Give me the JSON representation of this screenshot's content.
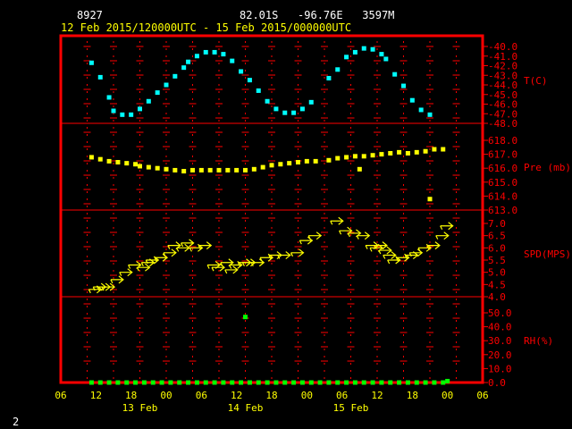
{
  "header": {
    "station": "8927",
    "location": "82.01S   -96.76E   3597M",
    "time_range": "12 Feb 2015/120000UTC - 15 Feb 2015/000000UTC",
    "page_number": "2"
  },
  "colors": {
    "background": "#000000",
    "frame": "#ff0000",
    "grid": "#ff0000",
    "axis_text": "#ff0000",
    "date_text": "#ffff00",
    "temperature": "#00ffff",
    "pressure": "#ffff00",
    "wind": "#ffff00",
    "rh": "#00ff00"
  },
  "chart_data": {
    "type": "scatter",
    "x_unit": "hours since 12 Feb 2015 00 UTC",
    "x_ticks": [
      "06",
      "12",
      "18",
      "00",
      "06",
      "12",
      "18",
      "00",
      "06",
      "12",
      "18",
      "00",
      "06"
    ],
    "date_labels": [
      "13 Feb",
      "14 Feb",
      "15 Feb"
    ],
    "grid": true,
    "panels": [
      {
        "name": "temperature",
        "label": "T(C)",
        "ylim": [
          -48,
          -40
        ],
        "ticks": [
          "-40.0",
          "-41.0",
          "-42.0",
          "-43.0",
          "-44.0",
          "-45.0",
          "-46.0",
          "-47.0",
          "-48.0"
        ],
        "marker": "square",
        "points": [
          [
            13,
            -41.7
          ],
          [
            15,
            -43.2
          ],
          [
            17,
            -45.3
          ],
          [
            18,
            -46.7
          ],
          [
            20,
            -47.1
          ],
          [
            22,
            -47.1
          ],
          [
            24,
            -46.5
          ],
          [
            26,
            -45.7
          ],
          [
            28,
            -44.8
          ],
          [
            30,
            -44.0
          ],
          [
            32,
            -43.1
          ],
          [
            34,
            -42.2
          ],
          [
            35,
            -41.6
          ],
          [
            37,
            -41.0
          ],
          [
            39,
            -40.6
          ],
          [
            41,
            -40.6
          ],
          [
            43,
            -40.8
          ],
          [
            45,
            -41.5
          ],
          [
            47,
            -42.6
          ],
          [
            49,
            -43.5
          ],
          [
            51,
            -44.6
          ],
          [
            53,
            -45.7
          ],
          [
            55,
            -46.5
          ],
          [
            57,
            -46.9
          ],
          [
            59,
            -46.9
          ],
          [
            61,
            -46.5
          ],
          [
            63,
            -45.8
          ],
          [
            67,
            -43.3
          ],
          [
            69,
            -42.4
          ],
          [
            71,
            -41.1
          ],
          [
            73,
            -40.6
          ],
          [
            75,
            -40.2
          ],
          [
            77,
            -40.3
          ],
          [
            79,
            -40.8
          ],
          [
            80,
            -41.3
          ],
          [
            82,
            -42.9
          ],
          [
            84,
            -44.1
          ],
          [
            86,
            -45.6
          ],
          [
            88,
            -46.6
          ],
          [
            90,
            -47.1
          ]
        ]
      },
      {
        "name": "pressure",
        "label": "Pre (mb)",
        "ylim": [
          612,
          619
        ],
        "ticks": [
          "618.0",
          "617.0",
          "616.0",
          "615.0",
          "614.0",
          "613.0"
        ],
        "marker": "square",
        "points": [
          [
            13,
            617.3
          ],
          [
            15,
            617.1
          ],
          [
            17,
            616.9
          ],
          [
            19,
            616.8
          ],
          [
            21,
            616.7
          ],
          [
            23,
            616.6
          ],
          [
            24,
            616.4
          ],
          [
            26,
            616.3
          ],
          [
            28,
            616.2
          ],
          [
            30,
            616.1
          ],
          [
            32,
            616.0
          ],
          [
            34,
            615.9
          ],
          [
            36,
            616.0
          ],
          [
            38,
            616.0
          ],
          [
            40,
            616.0
          ],
          [
            42,
            616.0
          ],
          [
            44,
            616.0
          ],
          [
            46,
            616.0
          ],
          [
            48,
            616.0
          ],
          [
            50,
            616.1
          ],
          [
            52,
            616.3
          ],
          [
            54,
            616.5
          ],
          [
            56,
            616.6
          ],
          [
            58,
            616.7
          ],
          [
            60,
            616.8
          ],
          [
            62,
            616.9
          ],
          [
            64,
            616.9
          ],
          [
            67,
            617.0
          ],
          [
            69,
            617.2
          ],
          [
            71,
            617.3
          ],
          [
            73,
            617.4
          ],
          [
            74,
            616.1
          ],
          [
            75,
            617.4
          ],
          [
            77,
            617.5
          ],
          [
            79,
            617.6
          ],
          [
            81,
            617.7
          ],
          [
            83,
            617.8
          ],
          [
            85,
            617.7
          ],
          [
            87,
            617.8
          ],
          [
            89,
            617.9
          ],
          [
            91,
            618.1
          ],
          [
            93,
            618.1
          ],
          [
            90,
            613.1
          ]
        ]
      },
      {
        "name": "wind_speed",
        "label": "SPD(MPS)",
        "ylim": [
          4,
          7
        ],
        "ticks": [
          "7.0",
          "6.5",
          "6.0",
          "5.5",
          "5.0",
          "4.5",
          "4.0"
        ],
        "marker": "wind-arrow",
        "points": [
          [
            14,
            4.3
          ],
          [
            15,
            4.4
          ],
          [
            16,
            4.4
          ],
          [
            17,
            4.4
          ],
          [
            19,
            4.7
          ],
          [
            21,
            5.0
          ],
          [
            23,
            5.3
          ],
          [
            25,
            5.2
          ],
          [
            26,
            5.4
          ],
          [
            27,
            5.5
          ],
          [
            29,
            5.6
          ],
          [
            31,
            5.8
          ],
          [
            32,
            6.1
          ],
          [
            34,
            6.0
          ],
          [
            35,
            6.2
          ],
          [
            37,
            6.0
          ],
          [
            39,
            6.1
          ],
          [
            41,
            5.3
          ],
          [
            42,
            5.2
          ],
          [
            44,
            5.4
          ],
          [
            45,
            5.1
          ],
          [
            46,
            5.3
          ],
          [
            48,
            5.4
          ],
          [
            49,
            5.4
          ],
          [
            51,
            5.4
          ],
          [
            53,
            5.6
          ],
          [
            55,
            5.7
          ],
          [
            57,
            5.7
          ],
          [
            60,
            5.8
          ],
          [
            62,
            6.3
          ],
          [
            64,
            6.5
          ],
          [
            69,
            7.1
          ],
          [
            71,
            6.7
          ],
          [
            73,
            6.6
          ],
          [
            75,
            6.5
          ],
          [
            77,
            6.1
          ],
          [
            78,
            6.0
          ],
          [
            79,
            6.1
          ],
          [
            80,
            5.9
          ],
          [
            81,
            5.7
          ],
          [
            82,
            5.5
          ],
          [
            84,
            5.6
          ],
          [
            86,
            5.7
          ],
          [
            87,
            5.8
          ],
          [
            89,
            6.0
          ],
          [
            91,
            6.1
          ],
          [
            93,
            6.5
          ],
          [
            94,
            6.9
          ]
        ]
      },
      {
        "name": "relative_humidity",
        "label": "RH(%)",
        "ylim": [
          0,
          50
        ],
        "ticks": [
          "50.0",
          "40.0",
          "30.0",
          "20.0",
          "10.0",
          "0.0"
        ],
        "marker": "square",
        "points": [
          [
            13,
            0
          ],
          [
            15,
            0
          ],
          [
            17,
            0
          ],
          [
            19,
            0
          ],
          [
            21,
            0
          ],
          [
            23,
            0
          ],
          [
            25,
            0
          ],
          [
            27,
            0
          ],
          [
            29,
            0
          ],
          [
            31,
            0
          ],
          [
            33,
            0
          ],
          [
            35,
            0
          ],
          [
            37,
            0
          ],
          [
            39,
            0
          ],
          [
            41,
            0
          ],
          [
            43,
            0
          ],
          [
            45,
            0
          ],
          [
            47,
            0
          ],
          [
            49,
            0
          ],
          [
            51,
            0
          ],
          [
            53,
            0
          ],
          [
            55,
            0
          ],
          [
            57,
            0
          ],
          [
            59,
            0
          ],
          [
            61,
            0
          ],
          [
            63,
            0
          ],
          [
            65,
            0
          ],
          [
            67,
            0
          ],
          [
            69,
            0
          ],
          [
            71,
            0
          ],
          [
            73,
            0
          ],
          [
            75,
            0
          ],
          [
            77,
            0
          ],
          [
            79,
            0
          ],
          [
            81,
            0
          ],
          [
            83,
            0
          ],
          [
            85,
            0
          ],
          [
            87,
            0
          ],
          [
            89,
            0
          ],
          [
            91,
            0
          ],
          [
            93,
            0
          ],
          [
            94,
            1
          ],
          [
            48,
            47
          ]
        ]
      }
    ]
  }
}
